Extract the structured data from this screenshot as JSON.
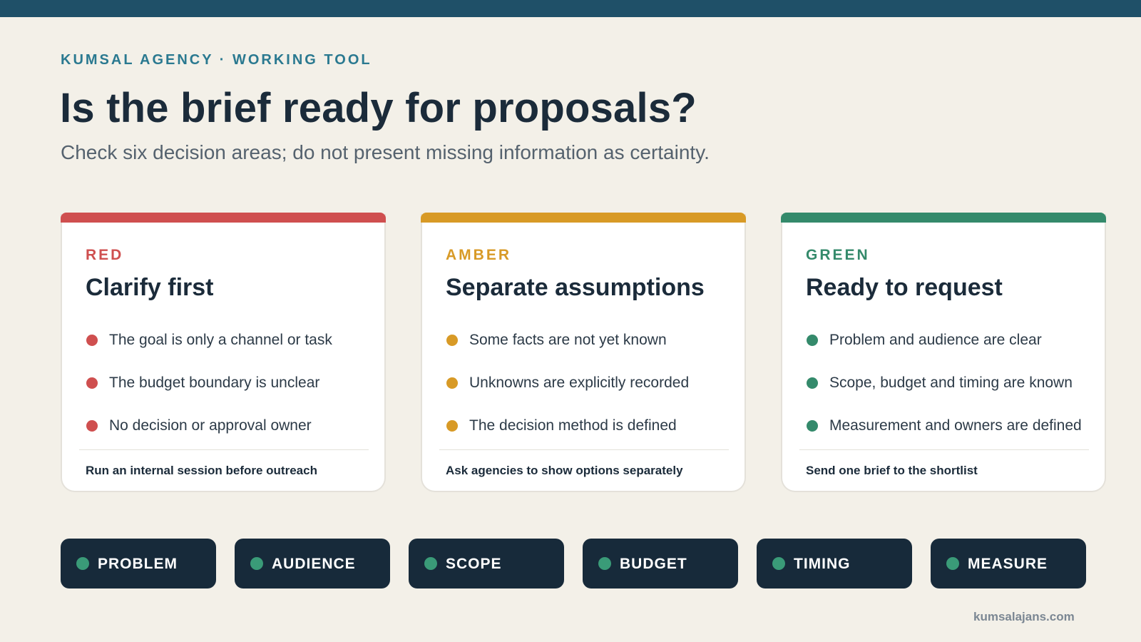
{
  "header": {
    "eyebrow": "KUMSAL AGENCY · WORKING TOOL",
    "title": "Is the brief ready for proposals?",
    "subtitle": "Check six decision areas; do not present missing information as certainty."
  },
  "colors": {
    "top_bar": "#1f5068",
    "red": "#cf4f4f",
    "amber": "#d89a26",
    "green": "#348a6b",
    "pill_dot": "#3a9b78"
  },
  "cards": [
    {
      "tag": "RED",
      "title": "Clarify first",
      "items": [
        "The goal is only a channel or task",
        "The budget boundary is unclear",
        "No decision or approval owner"
      ],
      "footer": "Run an internal session before outreach"
    },
    {
      "tag": "AMBER",
      "title": "Separate assumptions",
      "items": [
        "Some facts are not yet known",
        "Unknowns are explicitly recorded",
        "The decision method is defined"
      ],
      "footer": "Ask agencies to show options separately"
    },
    {
      "tag": "GREEN",
      "title": "Ready to request",
      "items": [
        "Problem and audience are clear",
        "Scope, budget and timing are known",
        "Measurement and owners are defined"
      ],
      "footer": "Send one brief to the shortlist"
    }
  ],
  "areas": [
    "PROBLEM",
    "AUDIENCE",
    "SCOPE",
    "BUDGET",
    "TIMING",
    "MEASURE"
  ],
  "footer": {
    "site": "kumsalajans.com"
  }
}
